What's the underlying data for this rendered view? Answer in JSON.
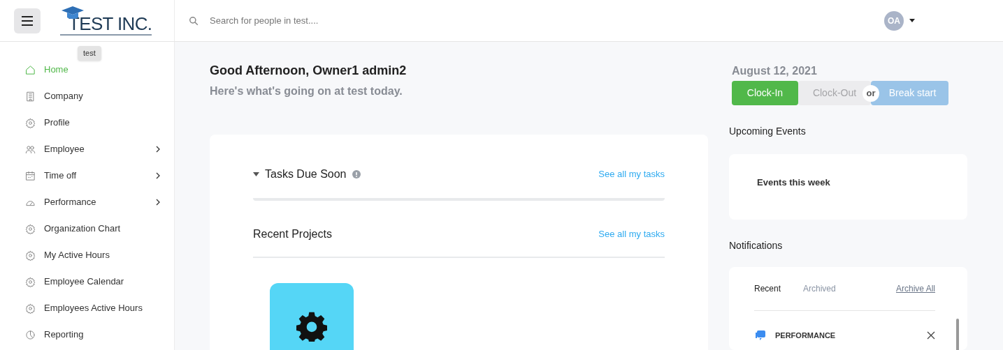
{
  "header": {
    "logo": "TEST INC.",
    "tooltip": "test",
    "search": {
      "placeholder": "Search for people in test...."
    },
    "avatar": "OA"
  },
  "sidebar": {
    "items": [
      {
        "label": "Home",
        "kind": "home",
        "selected": true,
        "expandable": false
      },
      {
        "label": "Company",
        "kind": "building",
        "selected": false,
        "expandable": false
      },
      {
        "label": "Profile",
        "kind": "gear",
        "selected": false,
        "expandable": false
      },
      {
        "label": "Employee",
        "kind": "people",
        "selected": false,
        "expandable": true
      },
      {
        "label": "Time off",
        "kind": "calendar",
        "selected": false,
        "expandable": true
      },
      {
        "label": "Performance",
        "kind": "gauge",
        "selected": false,
        "expandable": true
      },
      {
        "label": "Organization Chart",
        "kind": "gear",
        "selected": false,
        "expandable": false
      },
      {
        "label": "My Active Hours",
        "kind": "gear",
        "selected": false,
        "expandable": false
      },
      {
        "label": "Employee Calendar",
        "kind": "gear",
        "selected": false,
        "expandable": false
      },
      {
        "label": "Employees Active Hours",
        "kind": "gear",
        "selected": false,
        "expandable": false
      },
      {
        "label": "Reporting",
        "kind": "clock",
        "selected": false,
        "expandable": false
      }
    ]
  },
  "greeting": {
    "title": "Good Afternoon, Owner1 admin2",
    "subtitle": "Here's what's going on at test today."
  },
  "clock": {
    "date": "August 12, 2021",
    "separator": "or",
    "buttons": [
      {
        "label": "Clock-In",
        "kind": "primary"
      },
      {
        "label": "Clock-Out",
        "kind": "disabled"
      },
      {
        "label": "Break start",
        "kind": "secondary"
      }
    ]
  },
  "tasks": {
    "title": "Tasks Due Soon",
    "link": "See all my tasks",
    "expanded": true
  },
  "projects": {
    "title": "Recent Projects",
    "link": "See all my tasks",
    "tiles": [
      {
        "kind": "gear"
      }
    ]
  },
  "events": {
    "title": "Upcoming Events",
    "subtitle": "Events this week"
  },
  "notifications": {
    "title": "Notifications",
    "tabs": [
      {
        "label": "Recent",
        "selected": true
      },
      {
        "label": "Archived",
        "selected": false
      }
    ],
    "archive_all": "Archive All",
    "items": [
      {
        "label": "PERFORMANCE"
      }
    ]
  }
}
